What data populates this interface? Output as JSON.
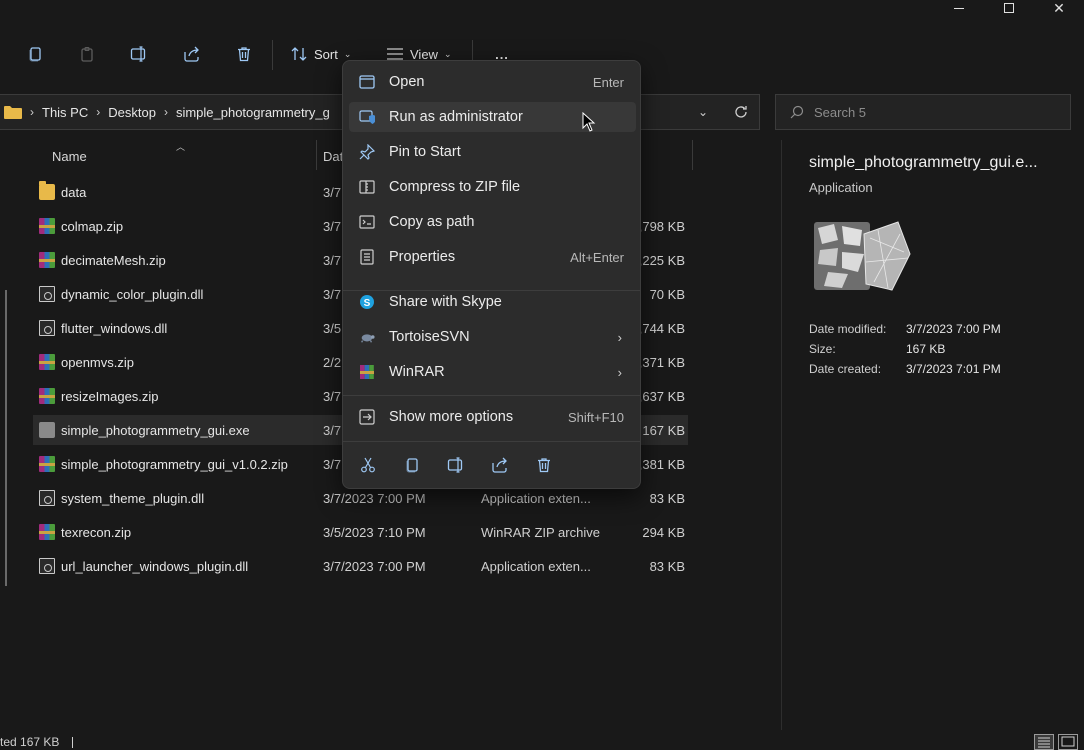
{
  "toolbar": {
    "sort_label": "Sort",
    "view_label": "View",
    "more_label": "..."
  },
  "address": {
    "crumbs": [
      "This PC",
      "Desktop",
      "simple_photogrammetry_g"
    ]
  },
  "search": {
    "placeholder": "Search 5"
  },
  "columns": {
    "name": "Name",
    "date": "Dat"
  },
  "files": [
    {
      "name": "data",
      "date": "3/7",
      "type": "",
      "size": "",
      "icon": "folder-icon"
    },
    {
      "name": "colmap.zip",
      "date": "3/7",
      "type": "",
      "size": ",798 KB",
      "icon": "winrar-zip-icon"
    },
    {
      "name": "decimateMesh.zip",
      "date": "3/7",
      "type": "",
      "size": ",225 KB",
      "icon": "winrar-zip-icon"
    },
    {
      "name": "dynamic_color_plugin.dll",
      "date": "3/7",
      "type": "",
      "size": "70 KB",
      "icon": "dll-file-icon"
    },
    {
      "name": "flutter_windows.dll",
      "date": "3/5",
      "type": "",
      "size": ",744 KB",
      "icon": "dll-file-icon"
    },
    {
      "name": "openmvs.zip",
      "date": "2/2",
      "type": "",
      "size": ",371 KB",
      "icon": "winrar-zip-icon"
    },
    {
      "name": "resizeImages.zip",
      "date": "3/7",
      "type": "",
      "size": ",637 KB",
      "icon": "winrar-zip-icon"
    },
    {
      "name": "simple_photogrammetry_gui.exe",
      "date": "3/7",
      "type": "",
      "size": "167 KB",
      "icon": "exe-file-icon"
    },
    {
      "name": "simple_photogrammetry_gui_v1.0.2.zip",
      "date": "3/7",
      "type": "",
      "size": ",381 KB",
      "icon": "winrar-zip-icon"
    },
    {
      "name": "system_theme_plugin.dll",
      "date": "3/7/2023 7:00 PM",
      "type": "Application exten...",
      "size": "83 KB",
      "icon": "dll-file-icon"
    },
    {
      "name": "texrecon.zip",
      "date": "3/5/2023 7:10 PM",
      "type": "WinRAR ZIP archive",
      "size": "294 KB",
      "icon": "winrar-zip-icon"
    },
    {
      "name": "url_launcher_windows_plugin.dll",
      "date": "3/7/2023 7:00 PM",
      "type": "Application exten...",
      "size": "83 KB",
      "icon": "dll-file-icon"
    }
  ],
  "details": {
    "title": "simple_photogrammetry_gui.e...",
    "subtitle": "Application",
    "rows": [
      {
        "label": "Date modified:",
        "value": "3/7/2023 7:00 PM"
      },
      {
        "label": "Size:",
        "value": "167 KB"
      },
      {
        "label": "Date created:",
        "value": "3/7/2023 7:01 PM"
      }
    ]
  },
  "context_menu": {
    "items": [
      {
        "label": "Open",
        "shortcut": "Enter",
        "icon": "open-app-icon"
      },
      {
        "label": "Run as administrator",
        "shortcut": "",
        "icon": "shield-icon"
      },
      {
        "label": "Pin to Start",
        "shortcut": "",
        "icon": "pin-icon"
      },
      {
        "label": "Compress to ZIP file",
        "shortcut": "",
        "icon": "zip-compress-icon"
      },
      {
        "label": "Copy as path",
        "shortcut": "",
        "icon": "copy-path-icon"
      },
      {
        "label": "Properties",
        "shortcut": "Alt+Enter",
        "icon": "properties-icon"
      },
      {
        "label": "Share with Skype",
        "shortcut": "",
        "icon": "skype-icon"
      },
      {
        "label": "TortoiseSVN",
        "shortcut": "",
        "icon": "tortoise-icon"
      },
      {
        "label": "WinRAR",
        "shortcut": "",
        "icon": "winrar-icon"
      },
      {
        "label": "Show more options",
        "shortcut": "Shift+F10",
        "icon": "more-options-icon"
      }
    ]
  },
  "status": {
    "text": "ted  167 KB"
  },
  "colors": {
    "accent": "#9fc9f5",
    "background": "#191919",
    "menu": "#2c2c2c"
  }
}
